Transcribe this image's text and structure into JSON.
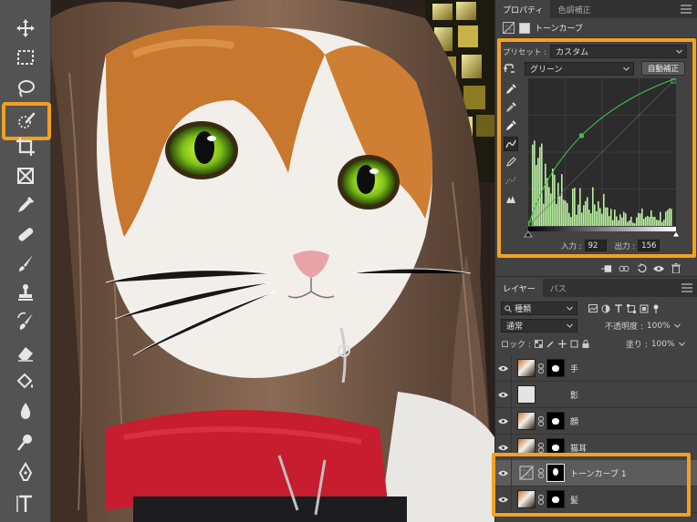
{
  "panel": {
    "tabs": [
      {
        "label": "プロパティ",
        "active": true
      },
      {
        "label": "色調補正",
        "active": false
      }
    ],
    "properties": {
      "title": "トーンカーブ",
      "preset_label": "プリセット :",
      "preset_value": "カスタム",
      "channel_value": "グリーン",
      "auto_button": "自動補正",
      "input_label": "入力 :",
      "input_value": "92",
      "output_label": "出力 :",
      "output_value": "156",
      "curve": {
        "color": "#3fbf4a",
        "points": [
          [
            0,
            0
          ],
          [
            92,
            156
          ],
          [
            255,
            255
          ]
        ],
        "range": [
          0,
          255
        ]
      }
    },
    "layers_panel": {
      "tabs": [
        {
          "label": "レイヤー",
          "active": true
        },
        {
          "label": "パス",
          "active": false
        }
      ],
      "filter_value": "種類",
      "blend_mode": "通常",
      "opacity_label": "不透明度 :",
      "opacity_value": "100%",
      "lock_label": "ロック :",
      "fill_label": "塗り :",
      "fill_value": "100%",
      "layers": [
        {
          "name": "手",
          "type": "image",
          "selected": false
        },
        {
          "name": "影",
          "type": "plain",
          "selected": false
        },
        {
          "name": "顔",
          "type": "image",
          "selected": false
        },
        {
          "name": "猫耳",
          "type": "image",
          "selected": false
        },
        {
          "name": "トーンカーブ 1",
          "type": "adjustment",
          "selected": true
        },
        {
          "name": "髪",
          "type": "image",
          "selected": false
        }
      ]
    }
  },
  "colors": {
    "highlight": "#f4a020",
    "panel_bg": "#424242",
    "toolbar_bg": "#535353",
    "histogram": "#b9f0a0"
  }
}
